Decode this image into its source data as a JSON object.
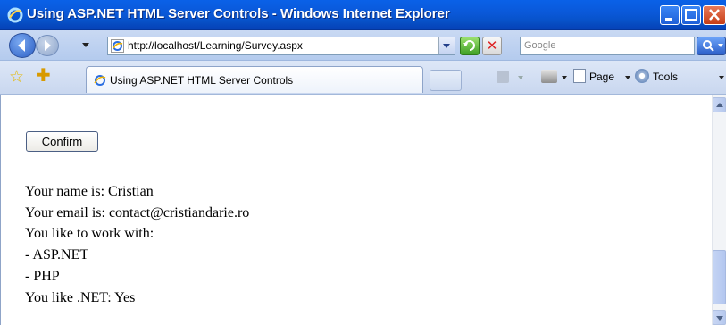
{
  "window": {
    "title": "Using ASP.NET HTML Server Controls - Windows Internet Explorer",
    "titlebar_color": "#0a58d8"
  },
  "navigation": {
    "address": "http://localhost/Learning/Survey.aspx",
    "search_placeholder": "Google"
  },
  "tabs": [
    {
      "label": "Using ASP.NET HTML Server Controls"
    }
  ],
  "command_bar": {
    "page_label": "Page",
    "tools_label": "Tools"
  },
  "page": {
    "confirm_label": "Confirm",
    "result_lines": [
      "Your name is: Cristian",
      "Your email is: contact@cristiandarie.ro",
      "You like to work with:",
      "- ASP.NET",
      "- PHP",
      "You like .NET: Yes"
    ]
  },
  "icons": [
    "ie-logo-icon",
    "back-icon",
    "forward-icon",
    "refresh-icon",
    "stop-icon",
    "search-icon",
    "favorites-star-icon",
    "add-favorite-icon",
    "feeds-icon",
    "print-icon",
    "page-icon",
    "tools-icon"
  ]
}
